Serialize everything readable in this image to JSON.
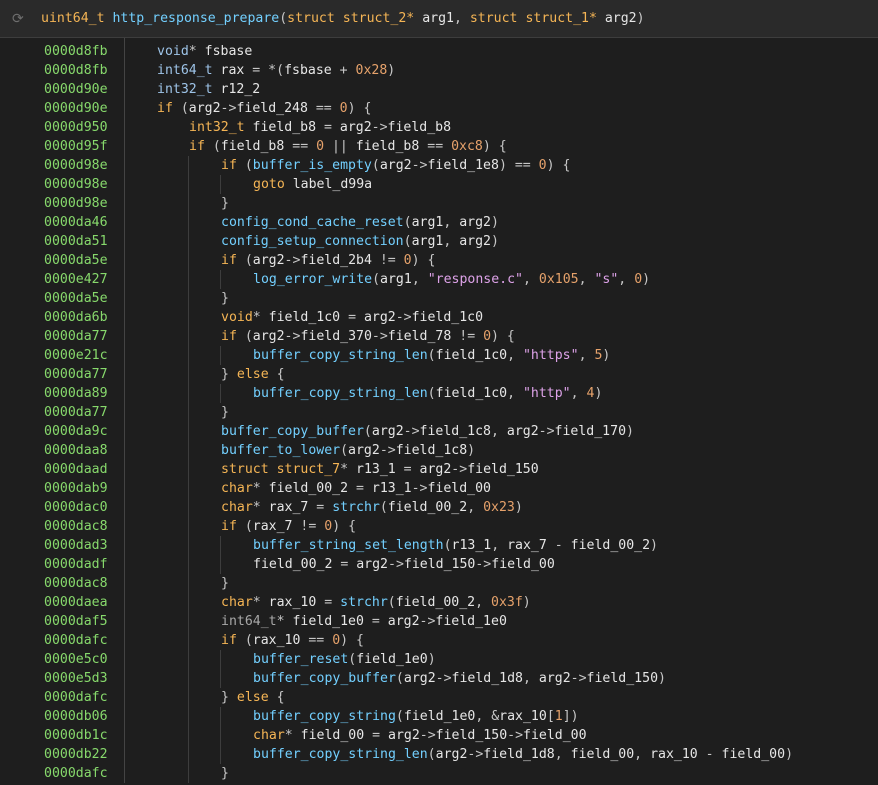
{
  "header": {
    "refresh_icon": "refresh-icon",
    "return_type": "uint64_t",
    "func_name": "http_response_prepare",
    "params": [
      {
        "kw": "struct",
        "type": "struct_2*",
        "name": "arg1"
      },
      {
        "kw": "struct",
        "type": "struct_1*",
        "name": "arg2"
      }
    ]
  },
  "lines": [
    {
      "addr": "0000d8fb",
      "indent": 0,
      "tokens": [
        [
          "ty",
          "void"
        ],
        [
          "op",
          "* "
        ],
        [
          "var",
          "fsbase"
        ]
      ]
    },
    {
      "addr": "0000d8fb",
      "indent": 0,
      "tokens": [
        [
          "ty",
          "int64_t "
        ],
        [
          "var",
          "rax"
        ],
        [
          "op",
          " = *("
        ],
        [
          "var",
          "fsbase"
        ],
        [
          "op",
          " + "
        ],
        [
          "num",
          "0x28"
        ],
        [
          "op",
          ")"
        ]
      ]
    },
    {
      "addr": "0000d90e",
      "indent": 0,
      "tokens": [
        [
          "ty",
          "int32_t "
        ],
        [
          "var",
          "r12_2"
        ]
      ]
    },
    {
      "addr": "0000d90e",
      "indent": 0,
      "tokens": [
        [
          "kw",
          "if"
        ],
        [
          "op",
          " ("
        ],
        [
          "var",
          "arg2"
        ],
        [
          "op",
          "->"
        ],
        [
          "var",
          "field_248"
        ],
        [
          "op",
          " == "
        ],
        [
          "num",
          "0"
        ],
        [
          "op",
          ") {"
        ]
      ]
    },
    {
      "addr": "0000d950",
      "indent": 1,
      "tokens": [
        [
          "kw",
          "int32_t "
        ],
        [
          "var",
          "field_b8"
        ],
        [
          "op",
          " = "
        ],
        [
          "var",
          "arg2"
        ],
        [
          "op",
          "->"
        ],
        [
          "var",
          "field_b8"
        ]
      ]
    },
    {
      "addr": "0000d95f",
      "indent": 1,
      "tokens": [
        [
          "kw",
          "if"
        ],
        [
          "op",
          " ("
        ],
        [
          "var",
          "field_b8"
        ],
        [
          "op",
          " == "
        ],
        [
          "num",
          "0"
        ],
        [
          "op",
          " || "
        ],
        [
          "var",
          "field_b8"
        ],
        [
          "op",
          " == "
        ],
        [
          "num",
          "0xc8"
        ],
        [
          "op",
          ") {"
        ]
      ]
    },
    {
      "addr": "0000d98e",
      "indent": 2,
      "tokens": [
        [
          "kw",
          "if"
        ],
        [
          "op",
          " ("
        ],
        [
          "fn",
          "buffer_is_empty"
        ],
        [
          "op",
          "("
        ],
        [
          "var",
          "arg2"
        ],
        [
          "op",
          "->"
        ],
        [
          "var",
          "field_1e8"
        ],
        [
          "op",
          ") == "
        ],
        [
          "num",
          "0"
        ],
        [
          "op",
          ") {"
        ]
      ]
    },
    {
      "addr": "0000d98e",
      "indent": 3,
      "tokens": [
        [
          "kw",
          "goto "
        ],
        [
          "var",
          "label_d99a"
        ]
      ]
    },
    {
      "addr": "0000d98e",
      "indent": 2,
      "tokens": [
        [
          "op",
          "}"
        ]
      ]
    },
    {
      "addr": "0000da46",
      "indent": 2,
      "tokens": [
        [
          "fn",
          "config_cond_cache_reset"
        ],
        [
          "op",
          "("
        ],
        [
          "var",
          "arg1"
        ],
        [
          "op",
          ", "
        ],
        [
          "var",
          "arg2"
        ],
        [
          "op",
          ")"
        ]
      ]
    },
    {
      "addr": "0000da51",
      "indent": 2,
      "tokens": [
        [
          "fn",
          "config_setup_connection"
        ],
        [
          "op",
          "("
        ],
        [
          "var",
          "arg1"
        ],
        [
          "op",
          ", "
        ],
        [
          "var",
          "arg2"
        ],
        [
          "op",
          ")"
        ]
      ]
    },
    {
      "addr": "0000da5e",
      "indent": 2,
      "tokens": [
        [
          "kw",
          "if"
        ],
        [
          "op",
          " ("
        ],
        [
          "var",
          "arg2"
        ],
        [
          "op",
          "->"
        ],
        [
          "var",
          "field_2b4"
        ],
        [
          "op",
          " != "
        ],
        [
          "num",
          "0"
        ],
        [
          "op",
          ") {"
        ]
      ]
    },
    {
      "addr": "0000e427",
      "indent": 3,
      "tokens": [
        [
          "fn",
          "log_error_write"
        ],
        [
          "op",
          "("
        ],
        [
          "var",
          "arg1"
        ],
        [
          "op",
          ", "
        ],
        [
          "str",
          "\"response.c\""
        ],
        [
          "op",
          ", "
        ],
        [
          "num",
          "0x105"
        ],
        [
          "op",
          ", "
        ],
        [
          "str",
          "\"s\""
        ],
        [
          "op",
          ", "
        ],
        [
          "num",
          "0"
        ],
        [
          "op",
          ")"
        ]
      ]
    },
    {
      "addr": "0000da5e",
      "indent": 2,
      "tokens": [
        [
          "op",
          "}"
        ]
      ]
    },
    {
      "addr": "0000da6b",
      "indent": 2,
      "tokens": [
        [
          "kw",
          "void"
        ],
        [
          "op",
          "* "
        ],
        [
          "var",
          "field_1c0"
        ],
        [
          "op",
          " = "
        ],
        [
          "var",
          "arg2"
        ],
        [
          "op",
          "->"
        ],
        [
          "var",
          "field_1c0"
        ]
      ]
    },
    {
      "addr": "0000da77",
      "indent": 2,
      "tokens": [
        [
          "kw",
          "if"
        ],
        [
          "op",
          " ("
        ],
        [
          "var",
          "arg2"
        ],
        [
          "op",
          "->"
        ],
        [
          "var",
          "field_370"
        ],
        [
          "op",
          "->"
        ],
        [
          "var",
          "field_78"
        ],
        [
          "op",
          " != "
        ],
        [
          "num",
          "0"
        ],
        [
          "op",
          ") {"
        ]
      ]
    },
    {
      "addr": "0000e21c",
      "indent": 3,
      "tokens": [
        [
          "fn",
          "buffer_copy_string_len"
        ],
        [
          "op",
          "("
        ],
        [
          "var",
          "field_1c0"
        ],
        [
          "op",
          ", "
        ],
        [
          "str",
          "\"https\""
        ],
        [
          "op",
          ", "
        ],
        [
          "num",
          "5"
        ],
        [
          "op",
          ")"
        ]
      ]
    },
    {
      "addr": "0000da77",
      "indent": 2,
      "tokens": [
        [
          "op",
          "} "
        ],
        [
          "kw",
          "else"
        ],
        [
          "op",
          " {"
        ]
      ]
    },
    {
      "addr": "0000da89",
      "indent": 3,
      "tokens": [
        [
          "fn",
          "buffer_copy_string_len"
        ],
        [
          "op",
          "("
        ],
        [
          "var",
          "field_1c0"
        ],
        [
          "op",
          ", "
        ],
        [
          "str",
          "\"http\""
        ],
        [
          "op",
          ", "
        ],
        [
          "num",
          "4"
        ],
        [
          "op",
          ")"
        ]
      ]
    },
    {
      "addr": "0000da77",
      "indent": 2,
      "tokens": [
        [
          "op",
          "}"
        ]
      ]
    },
    {
      "addr": "0000da9c",
      "indent": 2,
      "tokens": [
        [
          "fn",
          "buffer_copy_buffer"
        ],
        [
          "op",
          "("
        ],
        [
          "var",
          "arg2"
        ],
        [
          "op",
          "->"
        ],
        [
          "var",
          "field_1c8"
        ],
        [
          "op",
          ", "
        ],
        [
          "var",
          "arg2"
        ],
        [
          "op",
          "->"
        ],
        [
          "var",
          "field_170"
        ],
        [
          "op",
          ")"
        ]
      ]
    },
    {
      "addr": "0000daa8",
      "indent": 2,
      "tokens": [
        [
          "fn",
          "buffer_to_lower"
        ],
        [
          "op",
          "("
        ],
        [
          "var",
          "arg2"
        ],
        [
          "op",
          "->"
        ],
        [
          "var",
          "field_1c8"
        ],
        [
          "op",
          ")"
        ]
      ]
    },
    {
      "addr": "0000daad",
      "indent": 2,
      "tokens": [
        [
          "kw",
          "struct "
        ],
        [
          "kw",
          "struct_7"
        ],
        [
          "op",
          "* "
        ],
        [
          "var",
          "r13_1"
        ],
        [
          "op",
          " = "
        ],
        [
          "var",
          "arg2"
        ],
        [
          "op",
          "->"
        ],
        [
          "var",
          "field_150"
        ]
      ]
    },
    {
      "addr": "0000dab9",
      "indent": 2,
      "tokens": [
        [
          "kw",
          "char"
        ],
        [
          "op",
          "* "
        ],
        [
          "var",
          "field_00_2"
        ],
        [
          "op",
          " = "
        ],
        [
          "var",
          "r13_1"
        ],
        [
          "op",
          "->"
        ],
        [
          "var",
          "field_00"
        ]
      ]
    },
    {
      "addr": "0000dac0",
      "indent": 2,
      "tokens": [
        [
          "kw",
          "char"
        ],
        [
          "op",
          "* "
        ],
        [
          "var",
          "rax_7"
        ],
        [
          "op",
          " = "
        ],
        [
          "fn",
          "strchr"
        ],
        [
          "op",
          "("
        ],
        [
          "var",
          "field_00_2"
        ],
        [
          "op",
          ", "
        ],
        [
          "num",
          "0x23"
        ],
        [
          "op",
          ")"
        ]
      ]
    },
    {
      "addr": "0000dac8",
      "indent": 2,
      "tokens": [
        [
          "kw",
          "if"
        ],
        [
          "op",
          " ("
        ],
        [
          "var",
          "rax_7"
        ],
        [
          "op",
          " != "
        ],
        [
          "num",
          "0"
        ],
        [
          "op",
          ") {"
        ]
      ]
    },
    {
      "addr": "0000dad3",
      "indent": 3,
      "tokens": [
        [
          "fn",
          "buffer_string_set_length"
        ],
        [
          "op",
          "("
        ],
        [
          "var",
          "r13_1"
        ],
        [
          "op",
          ", "
        ],
        [
          "var",
          "rax_7"
        ],
        [
          "op",
          " - "
        ],
        [
          "var",
          "field_00_2"
        ],
        [
          "op",
          ")"
        ]
      ]
    },
    {
      "addr": "0000dadf",
      "indent": 3,
      "tokens": [
        [
          "var",
          "field_00_2"
        ],
        [
          "op",
          " = "
        ],
        [
          "var",
          "arg2"
        ],
        [
          "op",
          "->"
        ],
        [
          "var",
          "field_150"
        ],
        [
          "op",
          "->"
        ],
        [
          "var",
          "field_00"
        ]
      ]
    },
    {
      "addr": "0000dac8",
      "indent": 2,
      "tokens": [
        [
          "op",
          "}"
        ]
      ]
    },
    {
      "addr": "0000daea",
      "indent": 2,
      "tokens": [
        [
          "kw",
          "char"
        ],
        [
          "op",
          "* "
        ],
        [
          "var",
          "rax_10"
        ],
        [
          "op",
          " = "
        ],
        [
          "fn",
          "strchr"
        ],
        [
          "op",
          "("
        ],
        [
          "var",
          "field_00_2"
        ],
        [
          "op",
          ", "
        ],
        [
          "num",
          "0x3f"
        ],
        [
          "op",
          ")"
        ]
      ]
    },
    {
      "addr": "0000daf5",
      "indent": 2,
      "tokens": [
        [
          "pl",
          "int64_t"
        ],
        [
          "op",
          "* "
        ],
        [
          "var",
          "field_1e0"
        ],
        [
          "op",
          " = "
        ],
        [
          "var",
          "arg2"
        ],
        [
          "op",
          "->"
        ],
        [
          "var",
          "field_1e0"
        ]
      ]
    },
    {
      "addr": "0000dafc",
      "indent": 2,
      "tokens": [
        [
          "kw",
          "if"
        ],
        [
          "op",
          " ("
        ],
        [
          "var",
          "rax_10"
        ],
        [
          "op",
          " == "
        ],
        [
          "num",
          "0"
        ],
        [
          "op",
          ") {"
        ]
      ]
    },
    {
      "addr": "0000e5c0",
      "indent": 3,
      "tokens": [
        [
          "fn",
          "buffer_reset"
        ],
        [
          "op",
          "("
        ],
        [
          "var",
          "field_1e0"
        ],
        [
          "op",
          ")"
        ]
      ]
    },
    {
      "addr": "0000e5d3",
      "indent": 3,
      "tokens": [
        [
          "fn",
          "buffer_copy_buffer"
        ],
        [
          "op",
          "("
        ],
        [
          "var",
          "arg2"
        ],
        [
          "op",
          "->"
        ],
        [
          "var",
          "field_1d8"
        ],
        [
          "op",
          ", "
        ],
        [
          "var",
          "arg2"
        ],
        [
          "op",
          "->"
        ],
        [
          "var",
          "field_150"
        ],
        [
          "op",
          ")"
        ]
      ]
    },
    {
      "addr": "0000dafc",
      "indent": 2,
      "tokens": [
        [
          "op",
          "} "
        ],
        [
          "kw",
          "else"
        ],
        [
          "op",
          " {"
        ]
      ]
    },
    {
      "addr": "0000db06",
      "indent": 3,
      "tokens": [
        [
          "fn",
          "buffer_copy_string"
        ],
        [
          "op",
          "("
        ],
        [
          "var",
          "field_1e0"
        ],
        [
          "op",
          ", &"
        ],
        [
          "var",
          "rax_10"
        ],
        [
          "op",
          "["
        ],
        [
          "num",
          "1"
        ],
        [
          "op",
          "])"
        ]
      ]
    },
    {
      "addr": "0000db1c",
      "indent": 3,
      "tokens": [
        [
          "kw",
          "char"
        ],
        [
          "op",
          "* "
        ],
        [
          "var",
          "field_00"
        ],
        [
          "op",
          " = "
        ],
        [
          "var",
          "arg2"
        ],
        [
          "op",
          "->"
        ],
        [
          "var",
          "field_150"
        ],
        [
          "op",
          "->"
        ],
        [
          "var",
          "field_00"
        ]
      ]
    },
    {
      "addr": "0000db22",
      "indent": 3,
      "tokens": [
        [
          "fn",
          "buffer_copy_string_len"
        ],
        [
          "op",
          "("
        ],
        [
          "var",
          "arg2"
        ],
        [
          "op",
          "->"
        ],
        [
          "var",
          "field_1d8"
        ],
        [
          "op",
          ", "
        ],
        [
          "var",
          "field_00"
        ],
        [
          "op",
          ", "
        ],
        [
          "var",
          "rax_10"
        ],
        [
          "op",
          " - "
        ],
        [
          "var",
          "field_00"
        ],
        [
          "op",
          ")"
        ]
      ]
    },
    {
      "addr": "0000dafc",
      "indent": 2,
      "tokens": [
        [
          "op",
          "}"
        ]
      ]
    }
  ]
}
